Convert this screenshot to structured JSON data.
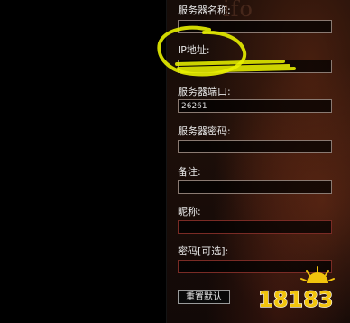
{
  "form": {
    "server_name": {
      "label": "服务器名称:",
      "value": ""
    },
    "ip_address": {
      "label": "IP地址:",
      "value": ""
    },
    "server_port": {
      "label": "服务器端口:",
      "value": "26261"
    },
    "server_password": {
      "label": "服务器密码:",
      "value": ""
    },
    "note": {
      "label": "备注:",
      "value": ""
    },
    "nickname": {
      "label": "昵称:",
      "value": ""
    },
    "password_optional": {
      "label": "密码[可选]:",
      "value": ""
    }
  },
  "buttons": {
    "reset_default": "重置默认"
  },
  "background_word": "ifo",
  "watermark": {
    "text": "18183",
    "icon": "sun-logo-icon"
  },
  "colors": {
    "highlight": "#e8f000",
    "watermark_yellow": "#f2c40d",
    "panel_bg": "#1a0d08"
  }
}
